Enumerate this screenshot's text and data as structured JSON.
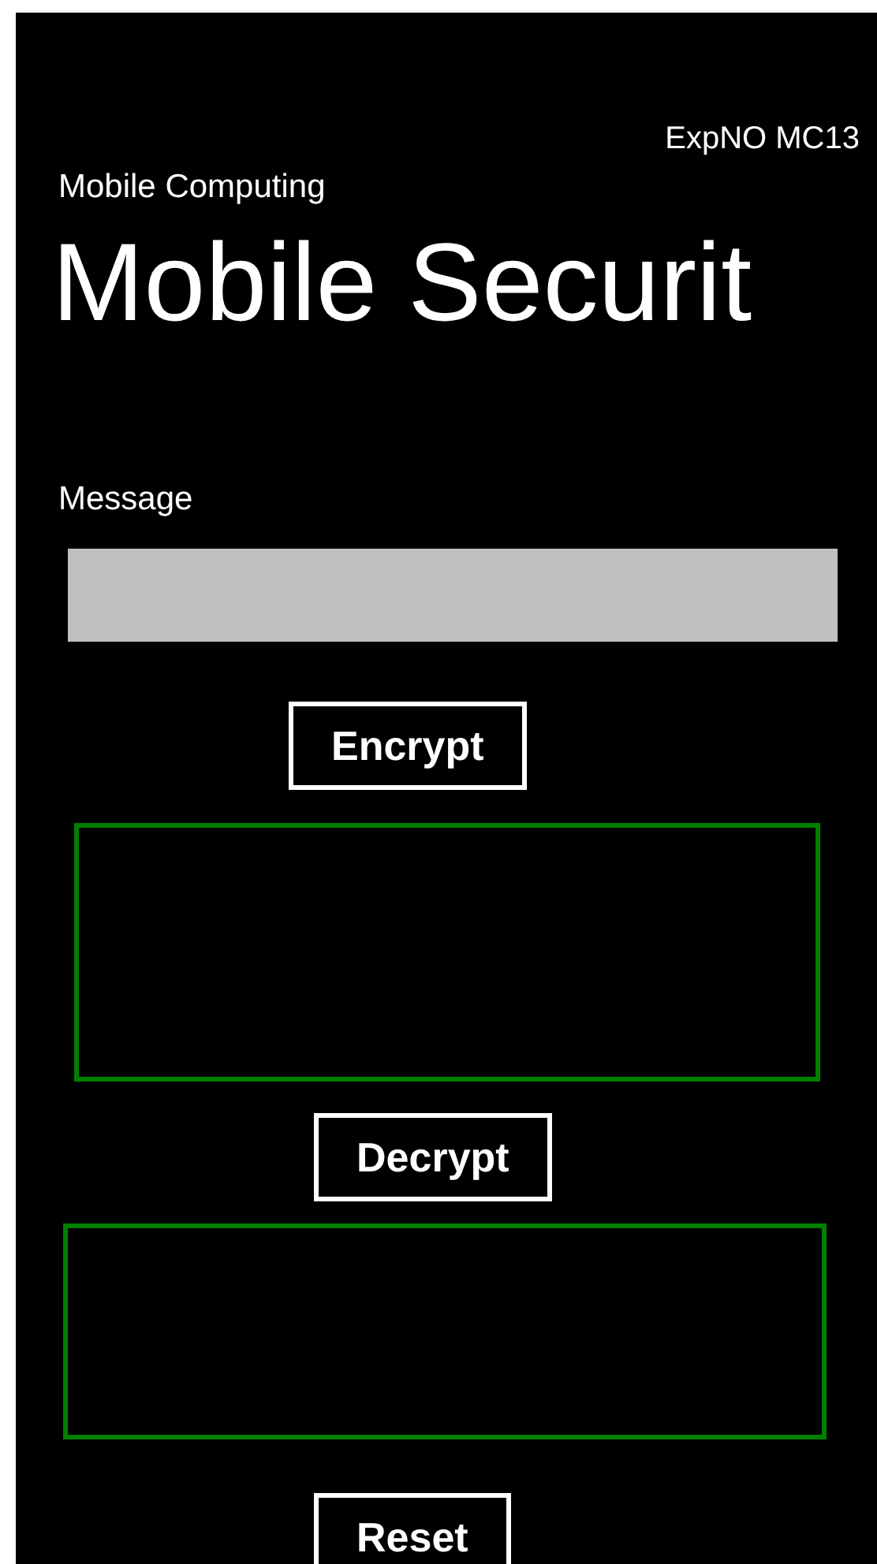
{
  "header": {
    "experiment": "ExpNO MC13",
    "app_name": "Mobile Computing",
    "page_title": "Mobile Securit"
  },
  "message": {
    "label": "Message"
  },
  "buttons": [
    {
      "kind": "encrypt",
      "label": "Encrypt"
    },
    {
      "kind": "decrypt",
      "label": "Decrypt"
    },
    {
      "kind": "reset",
      "label": "Reset"
    }
  ],
  "outputs": [
    {
      "kind": "encrypted"
    },
    {
      "kind": "decrypted"
    }
  ]
}
